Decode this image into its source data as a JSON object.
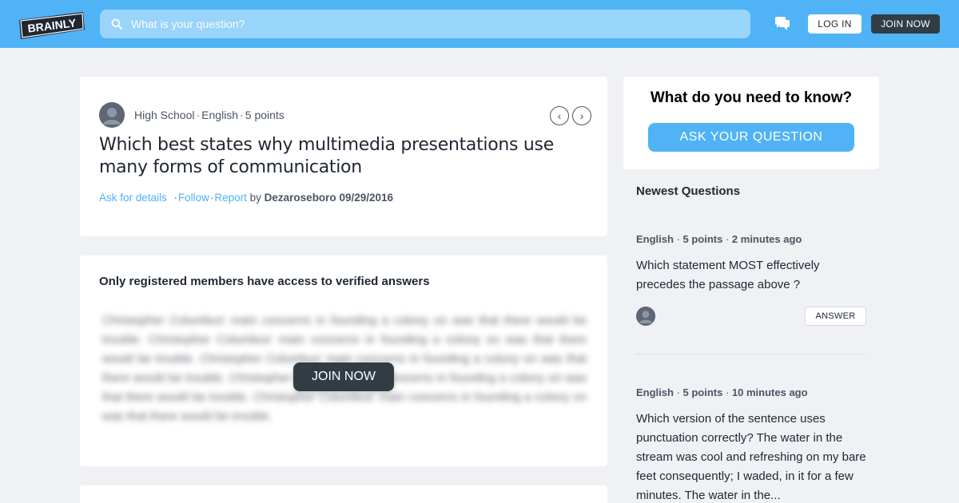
{
  "header": {
    "logo_text": "BRAINLY",
    "search_placeholder": "What is your question?",
    "login_label": "LOG IN",
    "join_label": "JOIN NOW"
  },
  "question": {
    "level": "High School",
    "subject": "English",
    "points": "5 points",
    "title": "Which best states why multimedia presentations use many forms of communication",
    "ask_details": "Ask for details",
    "follow": "Follow",
    "report": "Report",
    "by": "by",
    "author": "Dezaroseboro",
    "date": "09/29/2016"
  },
  "answer": {
    "heading": "Only registered members have access to verified answers",
    "blurred_text": "Christopher Columbus' main concerns in founding a colony on was that there would be trouble. Christopher Columbus' main concerns in founding a colony on was that there would be trouble. Christopher Columbus' main concerns in founding a colony on was that there would be trouble. Christopher Columbus' main concerns in founding a colony on was that there would be trouble. Christopher Columbus' main concerns in founding a colony on was that there would be trouble.",
    "join_label": "JOIN NOW"
  },
  "sidebar": {
    "ask_title": "What do you need to know?",
    "ask_button": "ASK YOUR QUESTION",
    "newest_title": "Newest Questions",
    "questions": [
      {
        "subject": "English",
        "points": "5 points",
        "time": "2 minutes ago",
        "text": "Which statement MOST effectively precedes the passage above ?",
        "answer_label": "ANSWER"
      },
      {
        "subject": "English",
        "points": "5 points",
        "time": "10 minutes ago",
        "text": "Which version of the sentence uses punctuation correctly? The water in the stream was cool and refreshing on my bare feet consequently; I waded, in it for a few minutes. The water in the..."
      }
    ]
  },
  "colors": {
    "brand_blue": "#4fb3f6",
    "dark_button": "#323c45",
    "page_bg": "#eff1f4"
  }
}
